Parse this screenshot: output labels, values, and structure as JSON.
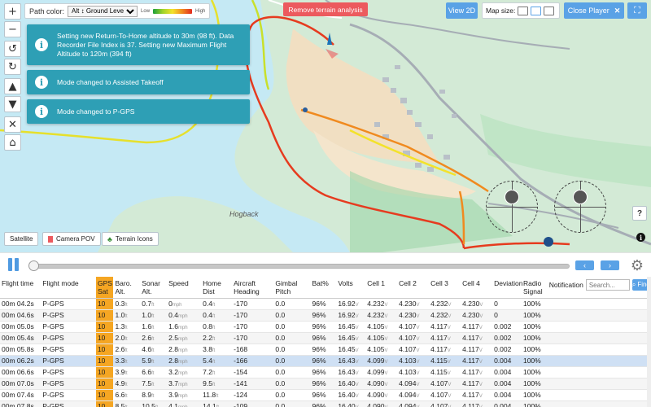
{
  "map": {
    "path_color_label": "Path color:",
    "path_color_value": "Alt ↕ Ground Level",
    "low_label": "Low",
    "high_label": "High",
    "remove_terrain_label": "Remove terrain analysis",
    "view2d_label": "View 2D",
    "map_size_label": "Map size:",
    "close_player_label": "Close Player",
    "satellite_label": "Satellite",
    "camera_pov_label": "Camera POV",
    "terrain_icons_label": "Terrain Icons",
    "place_label": "Hogback",
    "help_label": "?",
    "controls": [
      "+",
      "−",
      "↺",
      "↻",
      "▲",
      "▼",
      "✕",
      "⌂"
    ]
  },
  "notifications": [
    {
      "text": "Setting new Return-To-Home altitude to 30m (98 ft). Data Recorder File Index is 37. Setting new Maximum Flight Altitude to 120m (394 ft)"
    },
    {
      "text": "Mode changed to Assisted Takeoff"
    },
    {
      "text": "Mode changed to P-GPS"
    }
  ],
  "table": {
    "headers": [
      "Flight time",
      "Flight mode",
      "GPS Sat",
      "Baro. Alt.",
      "Sonar Alt.",
      "Speed",
      "Home Dist",
      "Aircraft Heading",
      "Gimbal Pitch",
      "Bat%",
      "Volts",
      "Cell 1",
      "Cell 2",
      "Cell 3",
      "Cell 4",
      "Deviation",
      "Radio Signal",
      "Notification"
    ],
    "search_placeholder": "Search...",
    "find_label": "Find",
    "rows": [
      [
        "00m 04.2s",
        "P-GPS",
        "10",
        "0.3",
        "0.7",
        "0",
        "0.4",
        "-170",
        "0.0",
        "96%",
        "16.92",
        "4.232",
        "4.230",
        "4.232",
        "4.230",
        "0",
        "100%"
      ],
      [
        "00m 04.6s",
        "P-GPS",
        "10",
        "1.0",
        "1.0",
        "0.4",
        "0.4",
        "-170",
        "0.0",
        "96%",
        "16.92",
        "4.232",
        "4.230",
        "4.232",
        "4.230",
        "0",
        "100%"
      ],
      [
        "00m 05.0s",
        "P-GPS",
        "10",
        "1.3",
        "1.6",
        "1.6",
        "0.8",
        "-170",
        "0.0",
        "96%",
        "16.45",
        "4.105",
        "4.107",
        "4.117",
        "4.117",
        "0.002",
        "100%"
      ],
      [
        "00m 05.4s",
        "P-GPS",
        "10",
        "2.0",
        "2.6",
        "2.5",
        "2.2",
        "-170",
        "0.0",
        "96%",
        "16.45",
        "4.105",
        "4.107",
        "4.117",
        "4.117",
        "0.002",
        "100%"
      ],
      [
        "00m 05.8s",
        "P-GPS",
        "10",
        "2.6",
        "4.6",
        "2.8",
        "3.8",
        "-168",
        "0.0",
        "96%",
        "16.45",
        "4.105",
        "4.107",
        "4.117",
        "4.117",
        "0.002",
        "100%"
      ],
      [
        "00m 06.2s",
        "P-GPS",
        "10",
        "3.3",
        "5.9",
        "2.8",
        "5.4",
        "-166",
        "0.0",
        "96%",
        "16.43",
        "4.099",
        "4.103",
        "4.115",
        "4.117",
        "0.004",
        "100%"
      ],
      [
        "00m 06.6s",
        "P-GPS",
        "10",
        "3.9",
        "6.6",
        "3.2",
        "7.2",
        "-154",
        "0.0",
        "96%",
        "16.43",
        "4.099",
        "4.103",
        "4.115",
        "4.117",
        "0.004",
        "100%"
      ],
      [
        "00m 07.0s",
        "P-GPS",
        "10",
        "4.9",
        "7.5",
        "3.7",
        "9.5",
        "-141",
        "0.0",
        "96%",
        "16.40",
        "4.090",
        "4.094",
        "4.107",
        "4.117",
        "0.004",
        "100%"
      ],
      [
        "00m 07.4s",
        "P-GPS",
        "10",
        "6.6",
        "8.9",
        "3.9",
        "11.8",
        "-124",
        "0.0",
        "96%",
        "16.40",
        "4.090",
        "4.094",
        "4.107",
        "4.117",
        "0.004",
        "100%"
      ],
      [
        "00m 07.8s",
        "P-GPS",
        "10",
        "8.5",
        "10.5",
        "4.1",
        "14.1",
        "-109",
        "0.0",
        "96%",
        "16.40",
        "4.090",
        "4.094",
        "4.107",
        "4.117",
        "0.004",
        "100%"
      ]
    ],
    "selected_row": 5,
    "units": {
      "alt": "ft",
      "speed": "mph",
      "dist": "ft",
      "volt": "V"
    }
  },
  "colors": {
    "accent_blue": "#5aa2e6",
    "toast_teal": "#2e9fb5",
    "remove_red": "#ec5a5e",
    "gps_orange": "#f5a623",
    "selected_row": "#cfe0f4"
  }
}
